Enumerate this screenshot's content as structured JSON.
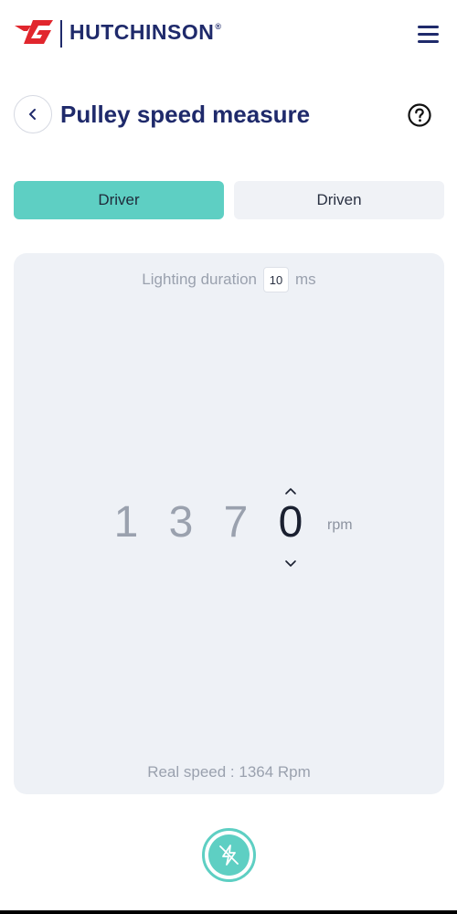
{
  "header": {
    "brand": "HUTCHINSON",
    "registered_mark": "®",
    "logo_icon": "hutchinson-logo-icon",
    "menu_icon": "hamburger-menu-icon"
  },
  "title_bar": {
    "back_icon": "chevron-left-icon",
    "title": "Pulley speed measure",
    "help_icon": "question-circle-icon"
  },
  "tabs": [
    {
      "label": "Driver",
      "active": true
    },
    {
      "label": "Driven",
      "active": false
    }
  ],
  "lighting": {
    "label": "Lighting duration",
    "value": "10",
    "unit": "ms"
  },
  "speed_selector": {
    "digits": [
      "1",
      "3",
      "7",
      "0"
    ],
    "active_digit_index": 3,
    "unit": "rpm",
    "up_icon": "chevron-up-icon",
    "down_icon": "chevron-down-icon"
  },
  "real_speed": {
    "text": "Real speed : 1364 Rpm"
  },
  "action": {
    "icon": "flash-off-icon"
  },
  "colors": {
    "brand_navy": "#1f2a6b",
    "brand_red": "#e1262d",
    "accent_teal": "#5ecfc3",
    "panel_bg": "#eef1f6"
  }
}
